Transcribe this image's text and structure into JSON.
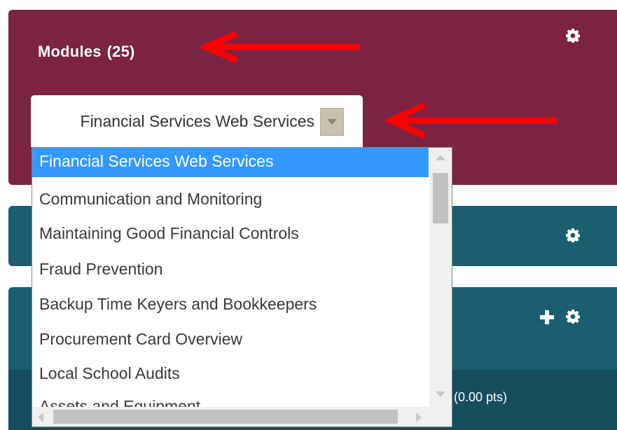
{
  "modules_panel": {
    "title": "Modules",
    "count": "(25)",
    "gear_icon": "gear-icon"
  },
  "module_select": {
    "selected_value": "Financial Services Web Services",
    "options": [
      "Financial Services Web Services",
      "Communication and Monitoring",
      "Maintaining Good Financial Controls",
      "Fraud Prevention",
      "Backup Time Keyers and Bookkeepers",
      "Procurement Card Overview",
      "Local School Audits",
      "Assets and Equipment"
    ]
  },
  "lower_panel": {
    "points_text": "(0.00 pts)"
  },
  "colors": {
    "modules_panel": "#7a2343",
    "teal_panel": "#1a5e70",
    "teal_panel_dark": "#154d5d",
    "selection": "#3399ff",
    "annotation_arrow": "#ff0000"
  }
}
